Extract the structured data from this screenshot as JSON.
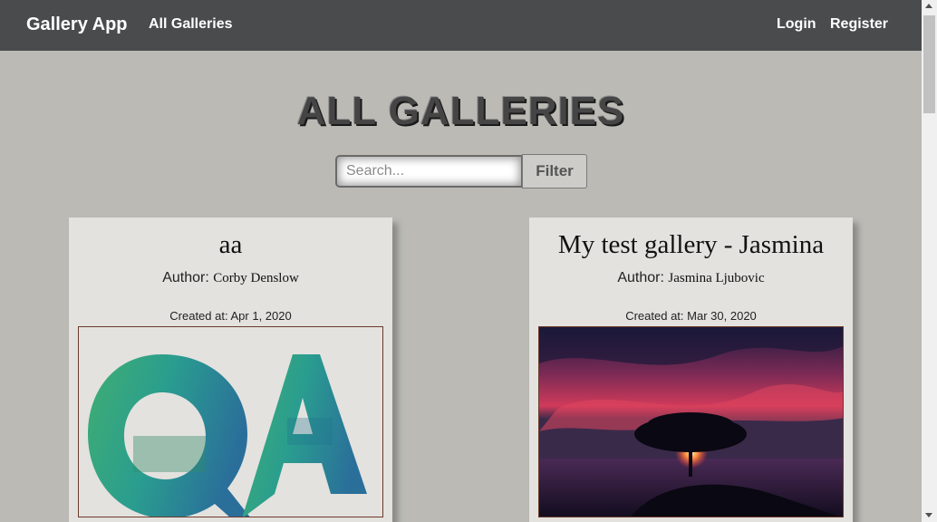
{
  "navbar": {
    "brand": "Gallery App",
    "all_galleries": "All Galleries",
    "login": "Login",
    "register": "Register",
    "background": "#4a4b4d"
  },
  "page": {
    "title": "ALL GALLERIES",
    "background": "#bbbab5"
  },
  "search": {
    "placeholder": "Search...",
    "value": "",
    "filter_label": "Filter"
  },
  "galleries": [
    {
      "title": "aa",
      "author_label": "Author:",
      "author": "Corby Denslow",
      "created_label": "Created at:",
      "created": "Apr 1, 2020",
      "image_icon": "qa-logo-image"
    },
    {
      "title": "My test gallery - Jasmina",
      "author_label": "Author:",
      "author": "Jasmina Ljubovic",
      "created_label": "Created at:",
      "created": "Mar 30, 2020",
      "image_icon": "sunset-tree-image"
    }
  ]
}
